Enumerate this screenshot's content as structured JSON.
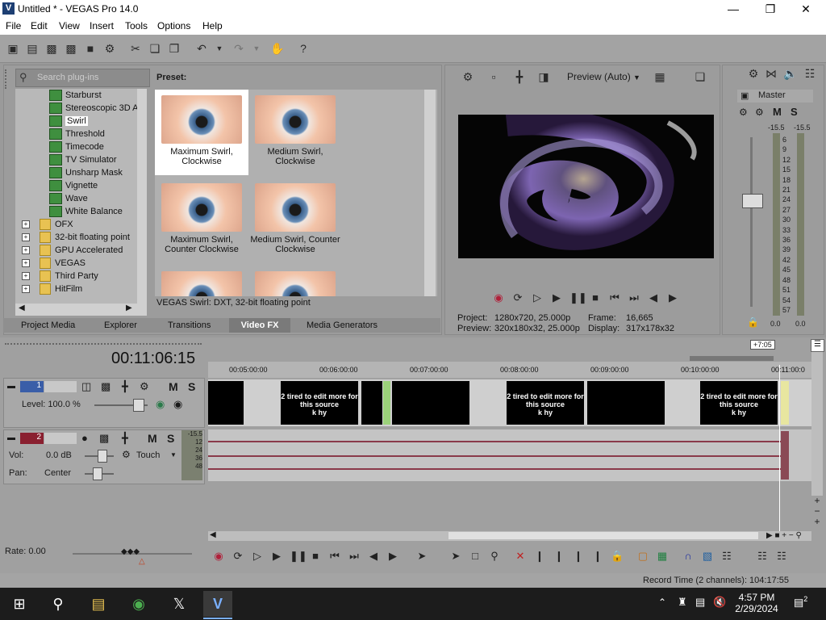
{
  "window": {
    "title": "Untitled * - VEGAS Pro 14.0",
    "logo": "V"
  },
  "menu": [
    "File",
    "Edit",
    "View",
    "Insert",
    "Tools",
    "Options",
    "Help"
  ],
  "plugins": {
    "search_placeholder": "Search plug-ins",
    "fx_items": [
      "Starburst",
      "Stereoscopic 3D A",
      "Swirl",
      "Threshold",
      "Timecode",
      "TV Simulator",
      "Unsharp Mask",
      "Vignette",
      "Wave",
      "White Balance"
    ],
    "selected": "Swirl",
    "folders": [
      "OFX",
      "32-bit floating point",
      "GPU Accelerated",
      "VEGAS",
      "Third Party",
      "HitFilm"
    ]
  },
  "preset": {
    "label": "Preset:",
    "items": [
      "Maximum Swirl, Clockwise",
      "Medium Swirl, Clockwise",
      "Maximum Swirl, Counter Clockwise",
      "Medium Swirl, Counter Clockwise",
      "",
      ""
    ],
    "info": "VEGAS Swirl: DXT, 32-bit floating point"
  },
  "tabs": [
    "Project Media",
    "Explorer",
    "Transitions",
    "Video FX",
    "Media Generators"
  ],
  "active_tab": "Video FX",
  "preview": {
    "mode": "Preview (Auto)",
    "project_label": "Project:",
    "project_value": "1280x720, 25.000p",
    "preview_label": "Preview:",
    "preview_value": "320x180x32, 25.000p",
    "frame_label": "Frame:",
    "frame_value": "16,665",
    "display_label": "Display:",
    "display_value": "317x178x32"
  },
  "mixer": {
    "master_label": "Master",
    "m": "M",
    "s": "S",
    "peak_left": "-15.5",
    "peak_right": "-15.5",
    "scale": [
      "6",
      "9",
      "12",
      "15",
      "18",
      "21",
      "24",
      "27",
      "30",
      "33",
      "36",
      "39",
      "42",
      "45",
      "48",
      "51",
      "54",
      "57"
    ],
    "bottom_left": "0.0",
    "bottom_right": "0.0"
  },
  "timeline": {
    "timecode": "00:11:06:15",
    "marker": "+7:05",
    "ruler": [
      "00:05:00:00",
      "00:06:00:00",
      "00:07:00:00",
      "00:08:00:00",
      "00:09:00:00",
      "00:10:00:00",
      "00:11:00:0"
    ],
    "clip_text": "2 tired to edit more for this source",
    "clip_text2": "k hy",
    "video_track": {
      "number": "1",
      "level_label": "Level: 100.0 %",
      "m": "M",
      "s": "S"
    },
    "audio_track": {
      "number": "2",
      "vol_label": "Vol:",
      "vol_value": "0.0 dB",
      "pan_label": "Pan:",
      "pan_value": "Center",
      "mode": "Touch",
      "m": "M",
      "s": "S",
      "meter": [
        "-15.5",
        "12",
        "24",
        "36",
        "48"
      ]
    },
    "rate": "Rate: 0.00"
  },
  "status": {
    "record_time": "Record Time (2 channels): 104:17:55"
  },
  "taskbar": {
    "time": "4:57 PM",
    "date": "2/29/2024",
    "notifications": "2"
  }
}
